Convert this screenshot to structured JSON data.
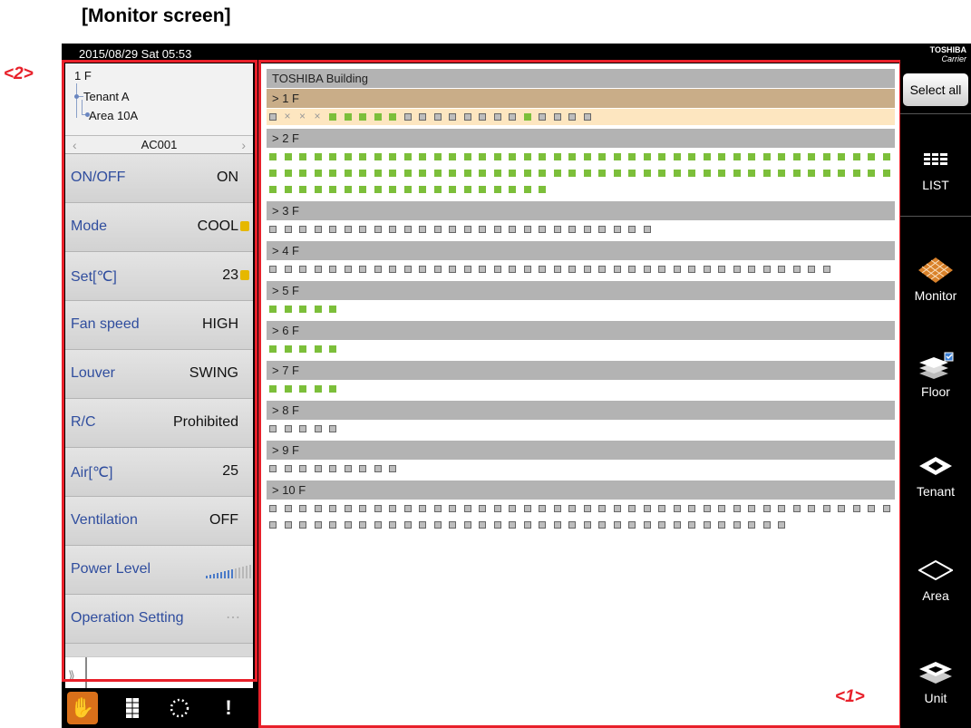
{
  "heading": "[Monitor screen]",
  "callouts": {
    "panel_label": "<2>",
    "monitor_label": "<1>"
  },
  "status_bar": {
    "datetime": "2015/08/29 Sat 05:53"
  },
  "brand": {
    "line1": "TOSHIBA",
    "line2": "Carrier"
  },
  "left_panel": {
    "tree": {
      "floor": "1 F",
      "tenant": "Tenant A",
      "area": "Area 10A"
    },
    "unit_selector": "AC001",
    "properties": [
      {
        "label": "ON/OFF",
        "value": "ON"
      },
      {
        "label": "Mode",
        "value": "COOL"
      },
      {
        "label": "Set[℃]",
        "value": "23"
      },
      {
        "label": "Fan speed",
        "value": "HIGH"
      },
      {
        "label": "Louver",
        "value": "SWING"
      },
      {
        "label": "R/C",
        "value": "Prohibited"
      },
      {
        "label": "Air[℃]",
        "value": "25"
      },
      {
        "label": "Ventilation",
        "value": "OFF"
      },
      {
        "label": "Power Level",
        "value": ""
      },
      {
        "label": "Operation Setting",
        "value": ""
      }
    ],
    "power_level": 0.6
  },
  "bottom_toolbar": [
    "hand-pointer-icon",
    "ladder-icon",
    "dotted-circle-icon",
    "exclamation-icon"
  ],
  "monitor": {
    "building": "TOSHIBA Building",
    "floors": [
      {
        "label": "> 1 F",
        "selected": true,
        "rows": [
          [
            "o",
            "x",
            "x",
            "x",
            "g",
            "g",
            "g",
            "g",
            "g",
            "o",
            "o",
            "o",
            "o",
            "o",
            "o",
            "o",
            "o",
            "g",
            "o",
            "o",
            "o",
            "o"
          ]
        ]
      },
      {
        "label": "> 2 F",
        "selected": false,
        "rows": [
          [
            "g",
            "g",
            "g",
            "g",
            "g",
            "g",
            "g",
            "g",
            "g",
            "g",
            "g",
            "g",
            "g",
            "g",
            "g",
            "g",
            "g",
            "g",
            "g",
            "g",
            "g",
            "g",
            "g",
            "g",
            "g",
            "g",
            "g",
            "g",
            "g",
            "g",
            "g",
            "g",
            "g",
            "g",
            "g",
            "g",
            "g",
            "g",
            "g",
            "g",
            "g",
            "g"
          ],
          [
            "g",
            "g",
            "g",
            "g",
            "g",
            "g",
            "g",
            "g",
            "g",
            "g",
            "g",
            "g",
            "g",
            "g",
            "g",
            "g",
            "g",
            "g",
            "g",
            "g",
            "g",
            "g",
            "g",
            "g",
            "g",
            "g",
            "g",
            "g",
            "g",
            "g",
            "g",
            "g",
            "g",
            "g",
            "g",
            "g",
            "g",
            "g",
            "g",
            "g",
            "g",
            "g"
          ],
          [
            "g",
            "g",
            "g",
            "g",
            "g",
            "g",
            "g",
            "g",
            "g",
            "g",
            "g",
            "g",
            "g",
            "g",
            "g",
            "g",
            "g",
            "g",
            "g"
          ]
        ]
      },
      {
        "label": "> 3 F",
        "selected": false,
        "rows": [
          [
            "o",
            "o",
            "o",
            "o",
            "o",
            "o",
            "o",
            "o",
            "o",
            "o",
            "o",
            "o",
            "o",
            "o",
            "o",
            "o",
            "o",
            "o",
            "o",
            "o",
            "o",
            "o",
            "o",
            "o",
            "o",
            "o"
          ]
        ]
      },
      {
        "label": "> 4 F",
        "selected": false,
        "rows": [
          [
            "o",
            "o",
            "o",
            "o",
            "o",
            "o",
            "o",
            "o",
            "o",
            "o",
            "o",
            "o",
            "o",
            "o",
            "o",
            "o",
            "o",
            "o",
            "o",
            "o",
            "o",
            "o",
            "o",
            "o",
            "o",
            "o",
            "o",
            "o",
            "o",
            "o",
            "o",
            "o",
            "o",
            "o",
            "o",
            "o",
            "o",
            "o"
          ]
        ]
      },
      {
        "label": "> 5 F",
        "selected": false,
        "rows": [
          [
            "g",
            "g",
            "g",
            "g",
            "g"
          ]
        ]
      },
      {
        "label": "> 6 F",
        "selected": false,
        "rows": [
          [
            "g",
            "g",
            "g",
            "g",
            "g"
          ]
        ]
      },
      {
        "label": "> 7 F",
        "selected": false,
        "rows": [
          [
            "g",
            "g",
            "g",
            "g",
            "g"
          ]
        ]
      },
      {
        "label": "> 8 F",
        "selected": false,
        "rows": [
          [
            "o",
            "o",
            "o",
            "o",
            "o"
          ]
        ]
      },
      {
        "label": "> 9 F",
        "selected": false,
        "rows": [
          [
            "o",
            "o",
            "o",
            "o",
            "o",
            "o",
            "o",
            "o",
            "o"
          ]
        ]
      },
      {
        "label": "> 10 F",
        "selected": false,
        "rows": [
          [
            "o",
            "o",
            "o",
            "o",
            "o",
            "o",
            "o",
            "o",
            "o",
            "o",
            "o",
            "o",
            "o",
            "o",
            "o",
            "o",
            "o",
            "o",
            "o",
            "o",
            "o",
            "o",
            "o",
            "o",
            "o",
            "o",
            "o",
            "o",
            "o",
            "o",
            "o",
            "o",
            "o",
            "o",
            "o",
            "o",
            "o",
            "o",
            "o",
            "o",
            "o",
            "o"
          ],
          [
            "o",
            "o",
            "o",
            "o",
            "o",
            "o",
            "o",
            "o",
            "o",
            "o",
            "o",
            "o",
            "o",
            "o",
            "o",
            "o",
            "o",
            "o",
            "o",
            "o",
            "o",
            "o",
            "o",
            "o",
            "o",
            "o",
            "o",
            "o",
            "o",
            "o",
            "o",
            "o",
            "o",
            "o",
            "o"
          ]
        ]
      }
    ]
  },
  "right_nav": {
    "select_all": "Select all",
    "items": [
      {
        "label": "LIST",
        "icon": "list-icon"
      },
      {
        "label": "Monitor",
        "icon": "monitor-grid-icon"
      },
      {
        "label": "Floor",
        "icon": "floor-stack-icon"
      },
      {
        "label": "Tenant",
        "icon": "tenant-icon"
      },
      {
        "label": "Area",
        "icon": "area-icon"
      },
      {
        "label": "Unit",
        "icon": "unit-icon"
      }
    ]
  },
  "colors": {
    "highlight": "#e8202a",
    "unit_on": "#7cbf3a",
    "unit_off": "#bdbdbd",
    "selected_floor": "#c9ad88",
    "label_blue": "#2f4d9e"
  }
}
